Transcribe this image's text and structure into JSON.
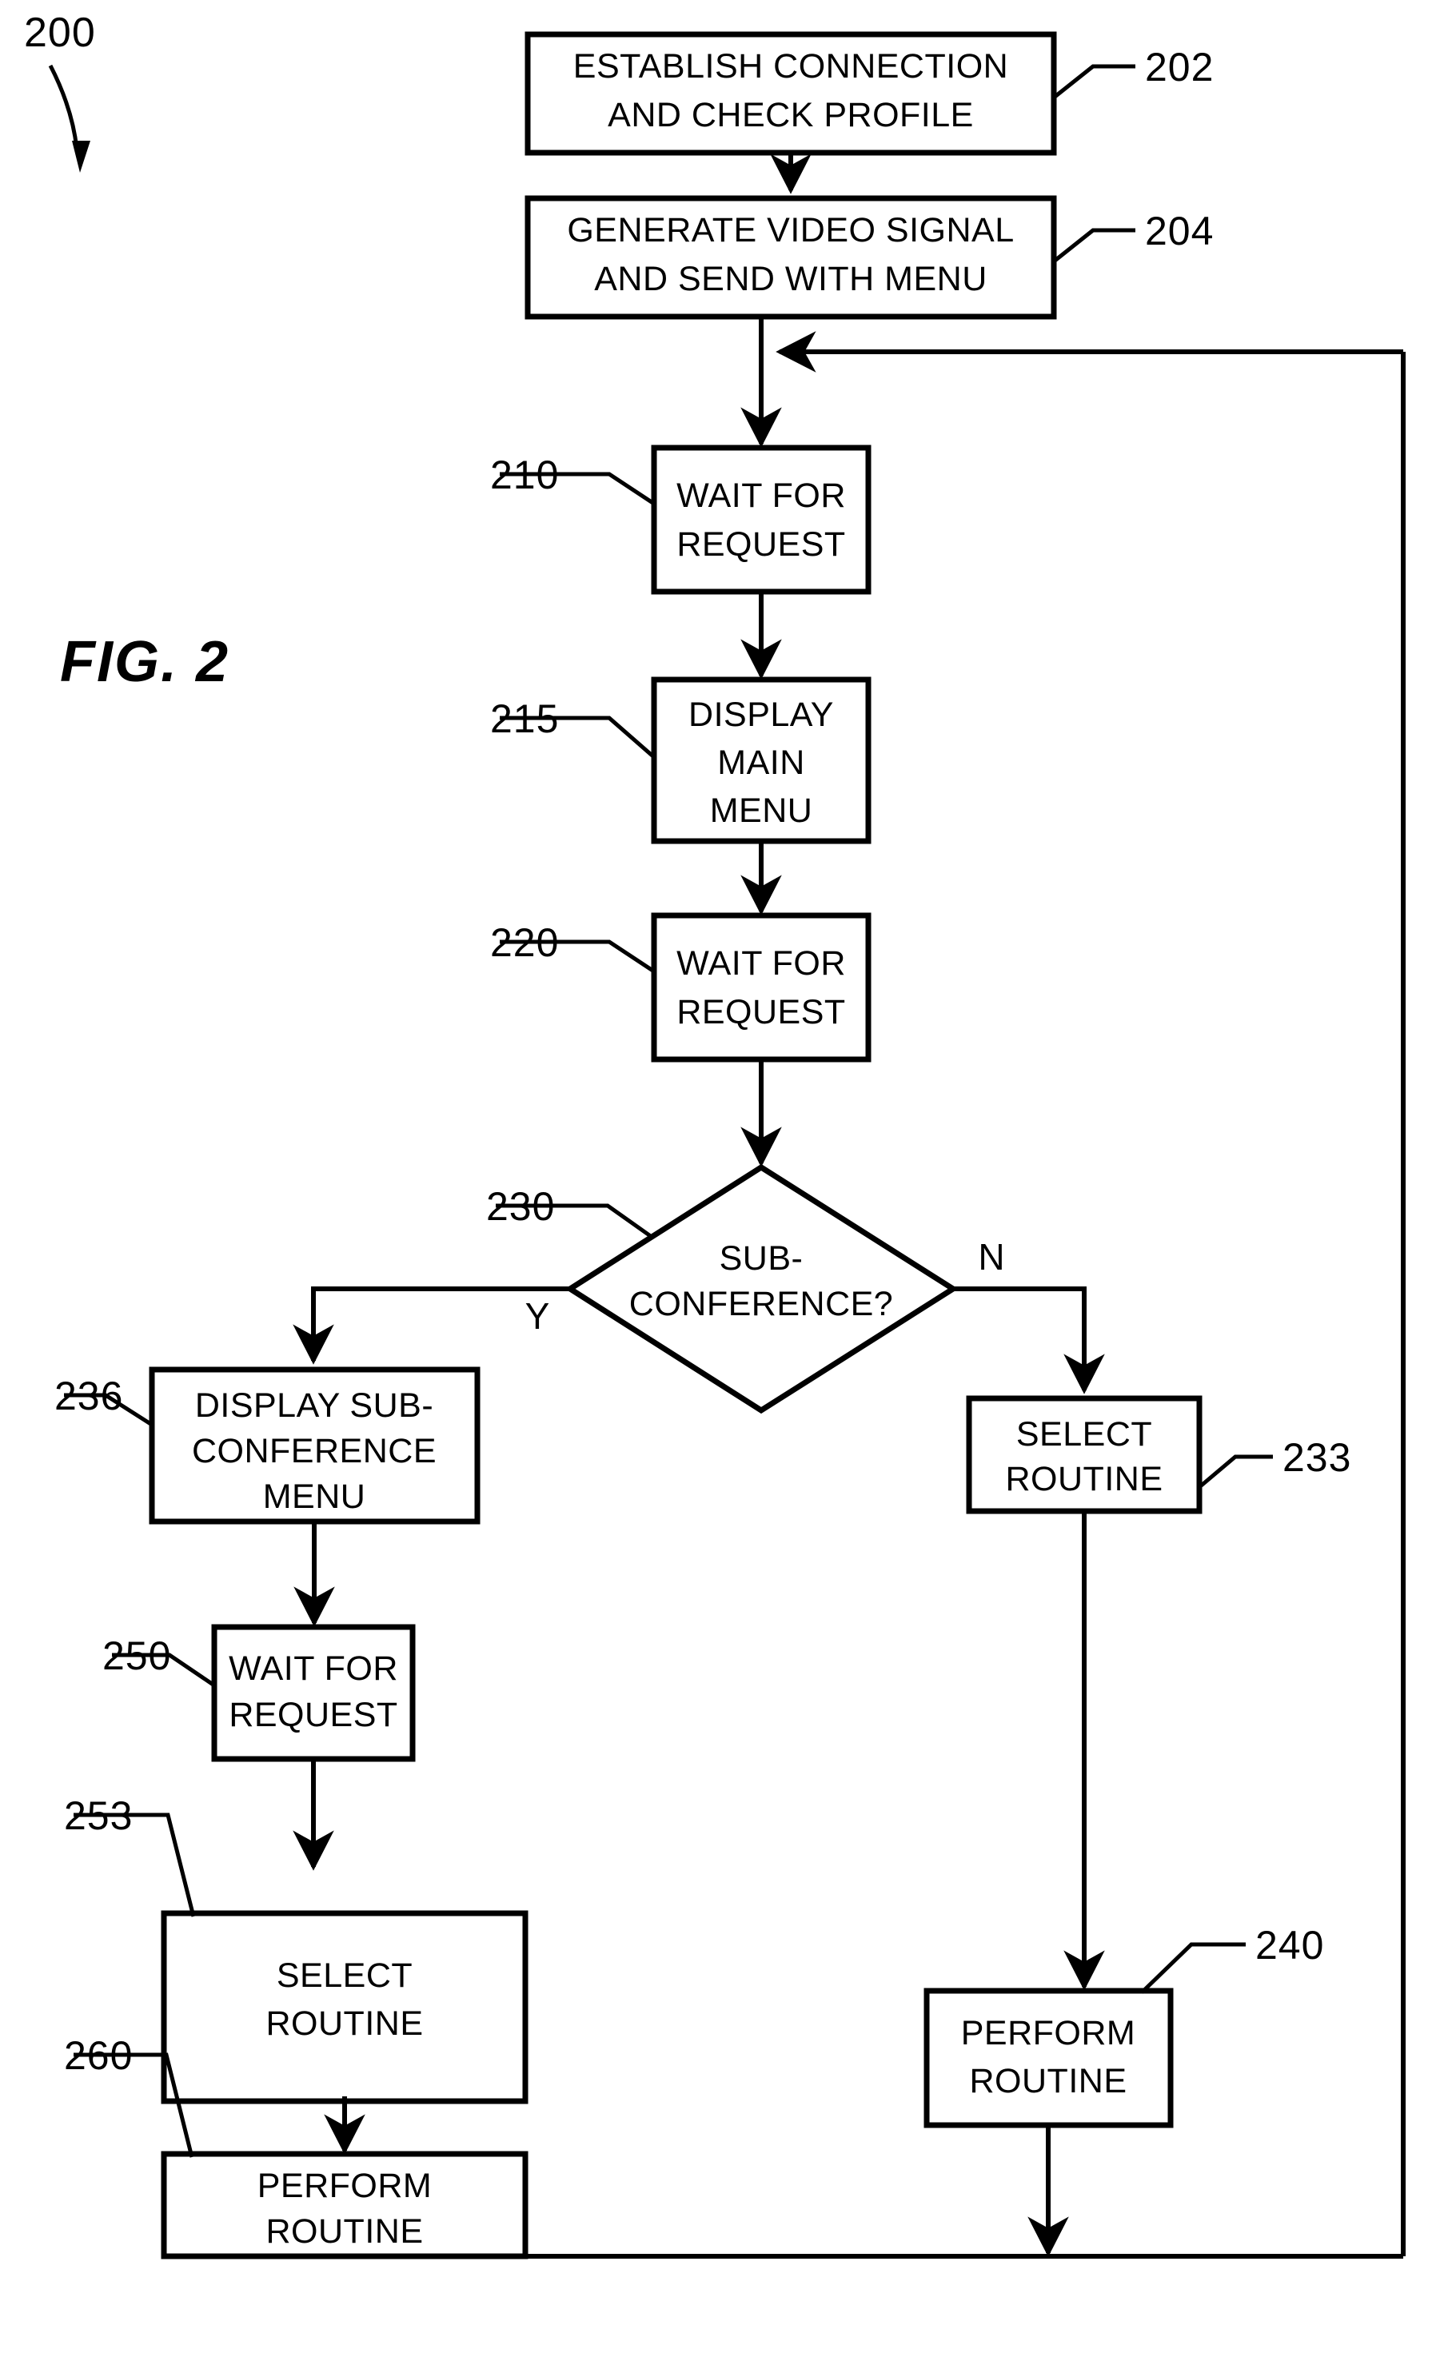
{
  "figure": {
    "caption": "FIG. 2",
    "identifier": "200"
  },
  "nodes": [
    {
      "id": "202",
      "ref": "202",
      "shape": "rectangle",
      "lines": [
        "ESTABLISH CONNECTION",
        "AND CHECK PROFILE"
      ]
    },
    {
      "id": "204",
      "ref": "204",
      "shape": "rectangle",
      "lines": [
        "GENERATE VIDEO SIGNAL",
        "AND SEND WITH MENU"
      ]
    },
    {
      "id": "210",
      "ref": "210",
      "shape": "rectangle",
      "lines": [
        "WAIT FOR",
        "REQUEST"
      ]
    },
    {
      "id": "215",
      "ref": "215",
      "shape": "rectangle",
      "lines": [
        "DISPLAY",
        "MAIN",
        "MENU"
      ]
    },
    {
      "id": "220",
      "ref": "220",
      "shape": "rectangle",
      "lines": [
        "WAIT FOR",
        "REQUEST"
      ]
    },
    {
      "id": "230",
      "ref": "230",
      "shape": "diamond",
      "lines": [
        "SUB-",
        "CONFERENCE?"
      ]
    },
    {
      "id": "233",
      "ref": "233",
      "shape": "rectangle",
      "lines": [
        "SELECT",
        "ROUTINE"
      ]
    },
    {
      "id": "236",
      "ref": "236",
      "shape": "rectangle",
      "lines": [
        "DISPLAY SUB-",
        "CONFERENCE",
        "MENU"
      ]
    },
    {
      "id": "240",
      "ref": "240",
      "shape": "rectangle",
      "lines": [
        "PERFORM",
        "ROUTINE"
      ]
    },
    {
      "id": "250",
      "ref": "250",
      "shape": "rectangle",
      "lines": [
        "WAIT FOR",
        "REQUEST"
      ]
    },
    {
      "id": "253",
      "ref": "253",
      "shape": "rectangle",
      "lines": [
        "SELECT",
        "ROUTINE"
      ]
    },
    {
      "id": "260",
      "ref": "260",
      "shape": "rectangle",
      "lines": [
        "PERFORM",
        "ROUTINE"
      ]
    }
  ],
  "branch_labels": {
    "yes": "Y",
    "no": "N"
  },
  "colors": {
    "stroke": "#000000",
    "fill": "#ffffff",
    "background": "#ffffff"
  }
}
